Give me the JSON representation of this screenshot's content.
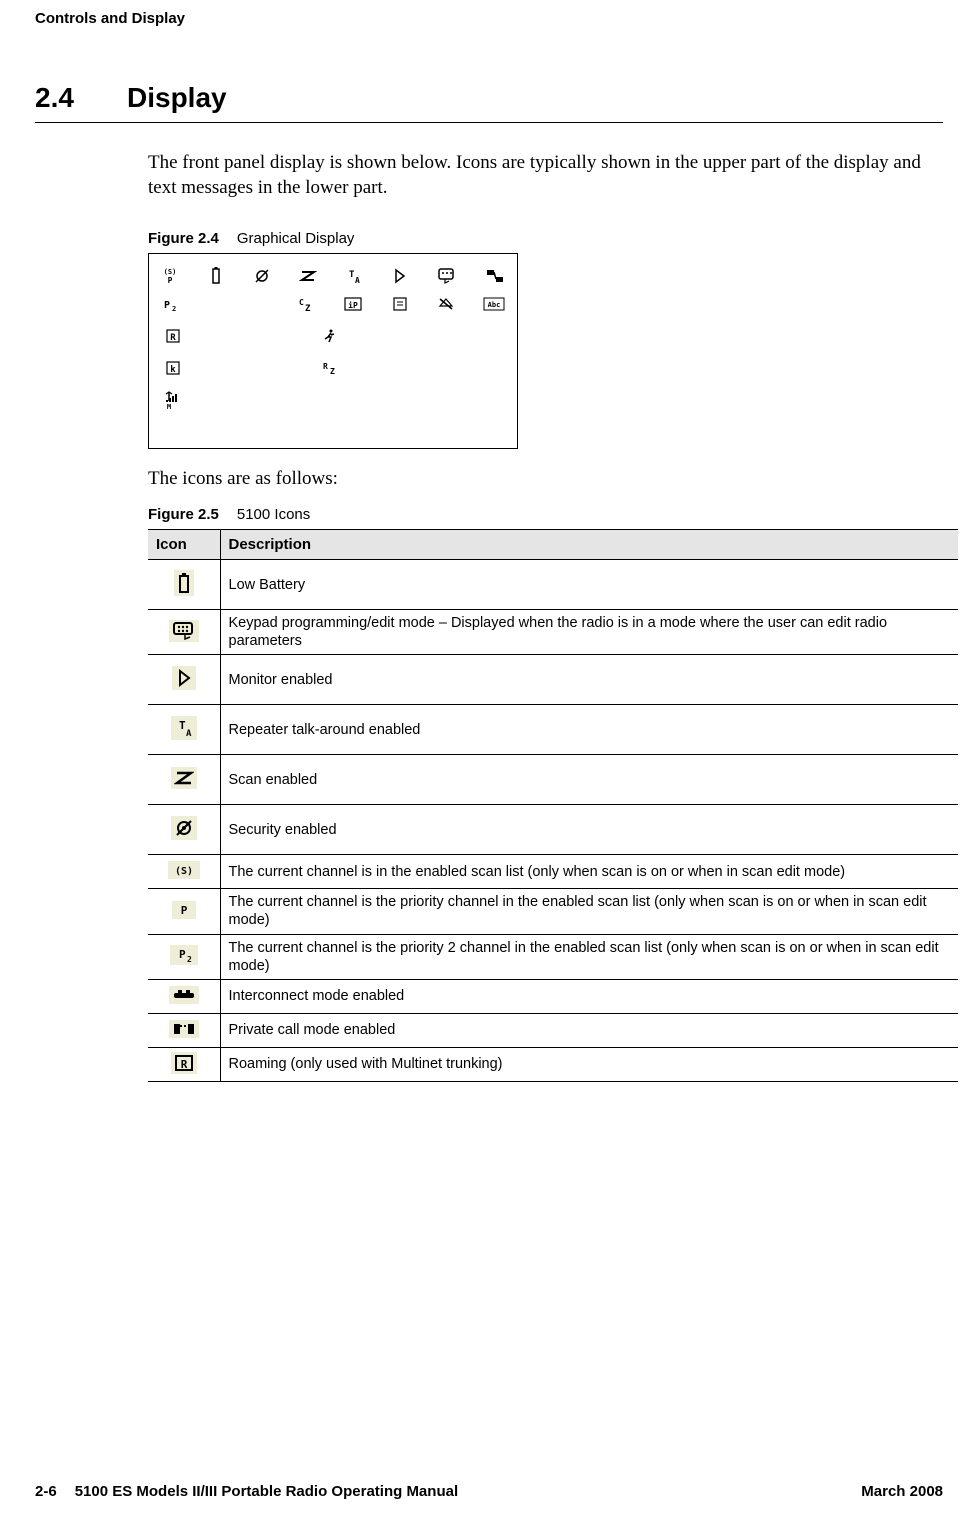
{
  "header": "Controls and Display",
  "section": {
    "number": "2.4",
    "title": "Display"
  },
  "intro": "The front panel display is shown below. Icons are typically shown in the upper part of the display and text messages in the lower part.",
  "figure24": {
    "label": "Figure 2.4",
    "caption": "Graphical Display"
  },
  "between": "The icons are as follows:",
  "figure25": {
    "label": "Figure 2.5",
    "caption": "5100 Icons"
  },
  "table": {
    "headers": {
      "icon": "Icon",
      "desc": "Description"
    },
    "rows": [
      {
        "icon": "low-battery",
        "desc": "Low Battery"
      },
      {
        "icon": "keypad-prog",
        "desc": "Keypad programming/edit mode – Displayed when the radio is in a mode where the user can edit radio parameters"
      },
      {
        "icon": "monitor",
        "desc": "Monitor enabled"
      },
      {
        "icon": "talkaround",
        "desc": "Repeater talk-around enabled"
      },
      {
        "icon": "scan",
        "desc": "Scan enabled"
      },
      {
        "icon": "security",
        "desc": "Security enabled"
      },
      {
        "icon": "scanlist",
        "desc": "The current channel is in the enabled scan list (only when scan is on or when in scan edit mode)"
      },
      {
        "icon": "priority",
        "desc": "The current channel is the priority channel in the enabled scan list (only when scan is on or when in scan edit mode)"
      },
      {
        "icon": "priority2",
        "desc": "The current channel is the priority 2 channel in the enabled scan list (only when scan is on or when in scan edit mode)"
      },
      {
        "icon": "interconnect",
        "desc": "Interconnect mode enabled"
      },
      {
        "icon": "privatecall",
        "desc": "Private call mode enabled"
      },
      {
        "icon": "roaming",
        "desc": "Roaming (only used with Multinet trunking)"
      }
    ]
  },
  "footer": {
    "page": "2-6",
    "title": "5100 ES Models II/III Portable Radio Operating Manual",
    "date": "March 2008"
  }
}
